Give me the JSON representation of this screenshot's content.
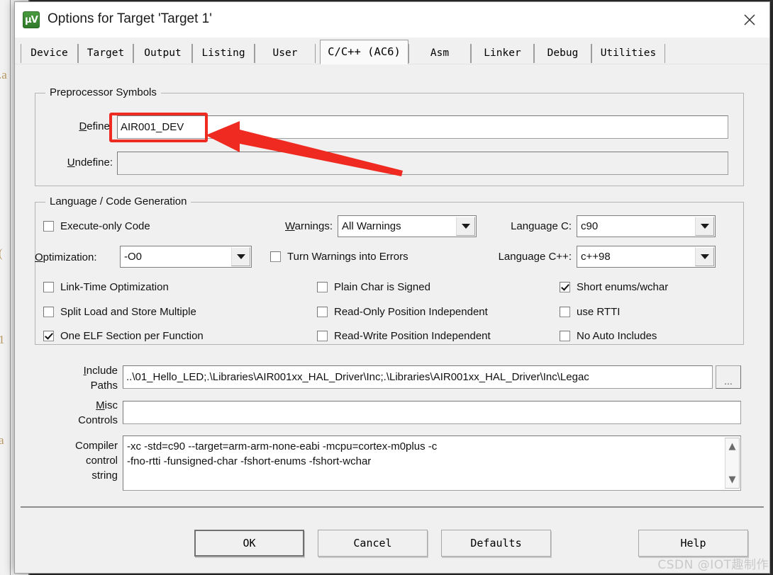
{
  "window": {
    "title": "Options for Target 'Target 1'",
    "app_icon": "uvision-icon",
    "close_label": "×"
  },
  "tabs": [
    {
      "label": "Device",
      "active": false
    },
    {
      "label": "Target",
      "active": false
    },
    {
      "label": "Output",
      "active": false
    },
    {
      "label": "Listing",
      "active": false
    },
    {
      "label": "User",
      "active": false
    },
    {
      "label": "C/C++ (AC6)",
      "active": true
    },
    {
      "label": "Asm",
      "active": false
    },
    {
      "label": "Linker",
      "active": false
    },
    {
      "label": "Debug",
      "active": false
    },
    {
      "label": "Utilities",
      "active": false
    }
  ],
  "preprocessor": {
    "legend": "Preprocessor Symbols",
    "define_label": "Define:",
    "define_value": "AIR001_DEV",
    "undefine_label": "Undefine:",
    "undefine_value": ""
  },
  "language": {
    "legend": "Language / Code Generation",
    "checkboxes_left": [
      {
        "label": "Execute-only Code",
        "checked": false
      },
      {
        "label": "Link-Time Optimization",
        "checked": false
      },
      {
        "label": "Split Load and Store Multiple",
        "checked": false
      },
      {
        "label": "One ELF Section per Function",
        "checked": true
      }
    ],
    "optimization_label": "Optimization:",
    "optimization_value": "-O0",
    "warnings_label": "Warnings:",
    "warnings_value": "All Warnings",
    "checkboxes_mid": [
      {
        "label": "Turn Warnings into Errors",
        "checked": false
      },
      {
        "label": "Plain Char is Signed",
        "checked": false
      },
      {
        "label": "Read-Only Position Independent",
        "checked": false
      },
      {
        "label": "Read-Write Position Independent",
        "checked": false
      }
    ],
    "language_c_label": "Language C:",
    "language_c_value": "c90",
    "language_cpp_label": "Language C++:",
    "language_cpp_value": "c++98",
    "checkboxes_right": [
      {
        "label": "Short enums/wchar",
        "checked": true
      },
      {
        "label": "use RTTI",
        "checked": false
      },
      {
        "label": "No Auto Includes",
        "checked": false
      }
    ]
  },
  "paths": {
    "include_label_line1": "Include",
    "include_label_line2": "Paths",
    "include_value": "..\\01_Hello_LED;.\\Libraries\\AIR001xx_HAL_Driver\\Inc;.\\Libraries\\AIR001xx_HAL_Driver\\Inc\\Legac",
    "browse_label": "...",
    "misc_label_line1": "Misc",
    "misc_label_line2": "Controls",
    "misc_value": "",
    "compiler_label_line1": "Compiler",
    "compiler_label_line2": "control",
    "compiler_label_line3": "string",
    "compiler_value": "-xc -std=c90 --target=arm-arm-none-eabi -mcpu=cortex-m0plus -c\n-fno-rtti -funsigned-char -fshort-enums -fshort-wchar",
    "scroll_up_glyph": "⌃",
    "scroll_down_glyph": "⌄"
  },
  "buttons": {
    "ok": "OK",
    "cancel": "Cancel",
    "defaults": "Defaults",
    "help": "Help"
  },
  "annotations": {
    "highlight_color": "#ef2a21",
    "arrow_color": "#ef2a21",
    "highlight_target": "define-input"
  },
  "watermark": "CSDN @IOT趣制作",
  "background_ghost_text": [
    ".a",
    "(",
    "1",
    "a"
  ]
}
